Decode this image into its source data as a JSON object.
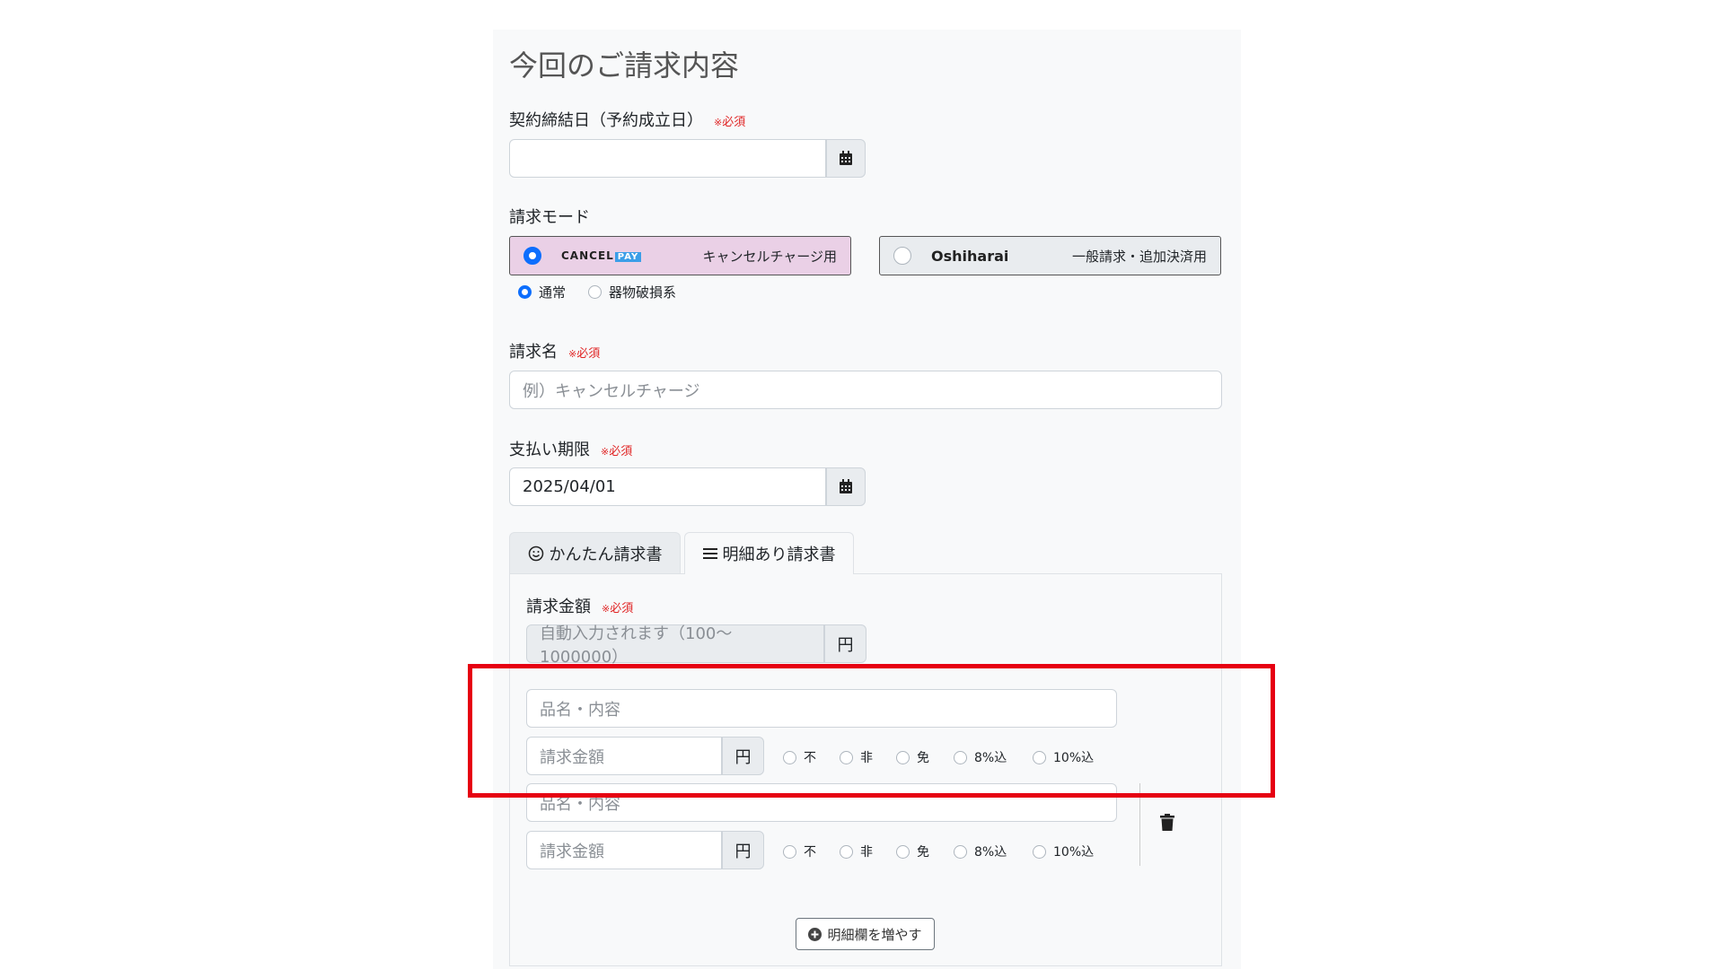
{
  "page_title": "今回のご請求内容",
  "required_mark": "必須",
  "contract_date": {
    "label": "契約締結日（予約成立日）",
    "value": ""
  },
  "billing_mode": {
    "label": "請求モード",
    "cancelpay": {
      "brand_left": "CANCEL",
      "brand_right": "PAY",
      "desc": "キャンセルチャージ用",
      "selected": true
    },
    "oshiharai": {
      "brand": "Oshiharai",
      "desc": "一般請求・追加決済用",
      "selected": false
    },
    "sub_options": [
      {
        "label": "通常",
        "selected": true
      },
      {
        "label": "器物破損系",
        "selected": false
      }
    ]
  },
  "billing_name": {
    "label": "請求名",
    "placeholder": "例）キャンセルチャージ"
  },
  "due_date": {
    "label": "支払い期限",
    "value": "2025/04/01"
  },
  "tabs": [
    {
      "label": "かんたん請求書",
      "active": false
    },
    {
      "label": "明細あり請求書",
      "active": true
    }
  ],
  "total_amount": {
    "label": "請求金額",
    "placeholder": "自動入力されます（100〜1000000）",
    "unit": "円"
  },
  "line_items": [
    {
      "item_placeholder": "品名・内容",
      "amount_placeholder": "請求金額",
      "unit": "円",
      "tax_options": [
        "不",
        "非",
        "免",
        "8%込",
        "10%込"
      ]
    },
    {
      "item_placeholder": "品名・内容",
      "amount_placeholder": "請求金額",
      "unit": "円",
      "tax_options": [
        "不",
        "非",
        "免",
        "8%込",
        "10%込"
      ]
    }
  ],
  "add_row_button": "明細欄を増やす",
  "colors": {
    "accent": "#0d6efd",
    "required": "#e02424",
    "highlight": "#e60012",
    "cancelpay_bg": "#ead0e6"
  }
}
